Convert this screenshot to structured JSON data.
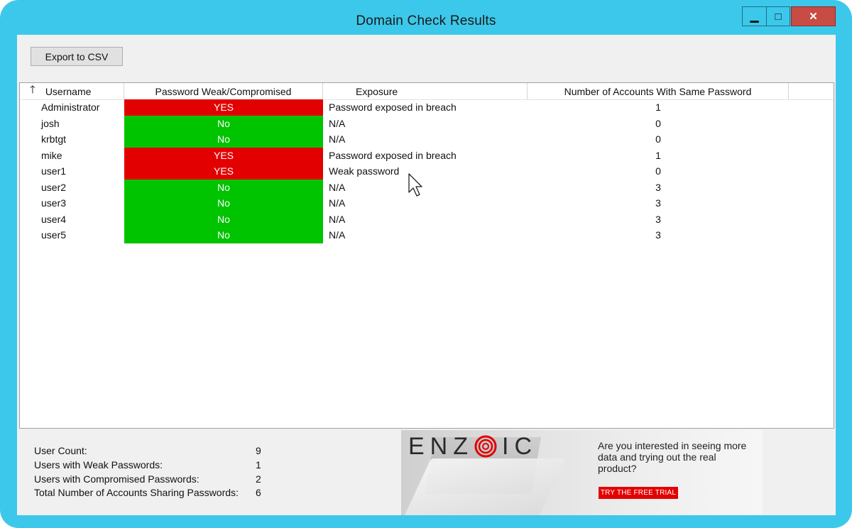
{
  "window": {
    "title": "Domain Check Results",
    "controls": {
      "minimize": "▁",
      "maximize": "□",
      "close": "✕"
    }
  },
  "toolbar": {
    "export_label": "Export to CSV"
  },
  "grid": {
    "sort_icon": "arrow-up-icon",
    "columns": [
      "Username",
      "Password Weak/Compromised",
      "Exposure",
      "Number of Accounts With Same Password"
    ],
    "rows": [
      {
        "username": "Administrator",
        "status": "YES",
        "exposure": "Password exposed in breach",
        "same_count": "1"
      },
      {
        "username": "josh",
        "status": "No",
        "exposure": "N/A",
        "same_count": "0"
      },
      {
        "username": "krbtgt",
        "status": "No",
        "exposure": "N/A",
        "same_count": "0"
      },
      {
        "username": "mike",
        "status": "YES",
        "exposure": "Password exposed in breach",
        "same_count": "1"
      },
      {
        "username": "user1",
        "status": "YES",
        "exposure": "Weak password",
        "same_count": "0"
      },
      {
        "username": "user2",
        "status": "No",
        "exposure": "N/A",
        "same_count": "3"
      },
      {
        "username": "user3",
        "status": "No",
        "exposure": "N/A",
        "same_count": "3"
      },
      {
        "username": "user4",
        "status": "No",
        "exposure": "N/A",
        "same_count": "3"
      },
      {
        "username": "user5",
        "status": "No",
        "exposure": "N/A",
        "same_count": "3"
      }
    ],
    "status_colors": {
      "YES": "#e30000",
      "No": "#00c400"
    }
  },
  "stats": {
    "items": [
      {
        "label": "User Count:",
        "value": "9"
      },
      {
        "label": "Users with Weak Passwords:",
        "value": "1"
      },
      {
        "label": "Users with Compromised Passwords:",
        "value": "2"
      },
      {
        "label": "Total Number of Accounts Sharing Passwords:",
        "value": "6"
      }
    ]
  },
  "banner": {
    "logo_left": "ENZ",
    "logo_right": "IC",
    "text": "Are you interested in seeing more data and trying out the real product?",
    "cta": "TRY THE FREE TRIAL",
    "accent": "#e30000"
  },
  "colors": {
    "frame": "#3cc8ea",
    "close_button": "#c84b44"
  }
}
